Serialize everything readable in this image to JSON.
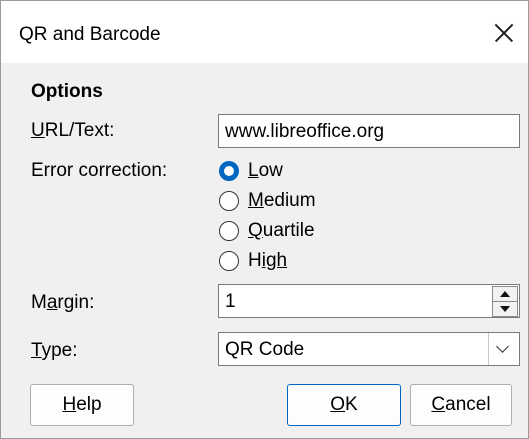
{
  "window": {
    "title": "QR and Barcode"
  },
  "options": {
    "section_title": "Options",
    "url_label_mnemonic": "U",
    "url_label_rest": "RL/Text:",
    "url_value": "www.libreoffice.org",
    "error_label": "Error correction:",
    "radios": [
      {
        "mnemonic": "L",
        "rest": "ow",
        "checked": true
      },
      {
        "mnemonic": "M",
        "rest": "edium",
        "checked": false
      },
      {
        "mnemonic": "Q",
        "rest": "uartile",
        "checked": false
      },
      {
        "mnemonic": "H",
        "rest_before": "",
        "rest": "igh",
        "checked": false
      }
    ],
    "margin_label_before": "M",
    "margin_label_mnemonic": "a",
    "margin_label_after": "rgin:",
    "margin_value": "1",
    "type_label_mnemonic": "T",
    "type_label_rest": "ype:",
    "type_value": "QR Code"
  },
  "buttons": {
    "help_mnemonic": "H",
    "help_rest": "elp",
    "ok_mnemonic": "O",
    "ok_rest": "K",
    "cancel_mnemonic": "C",
    "cancel_rest": "ancel"
  },
  "colors": {
    "accent": "#0067c0"
  },
  "icons": {
    "close": "close-icon",
    "spin_up": "chevron-up-icon",
    "spin_down": "chevron-down-icon",
    "combo": "chevron-down-icon"
  }
}
